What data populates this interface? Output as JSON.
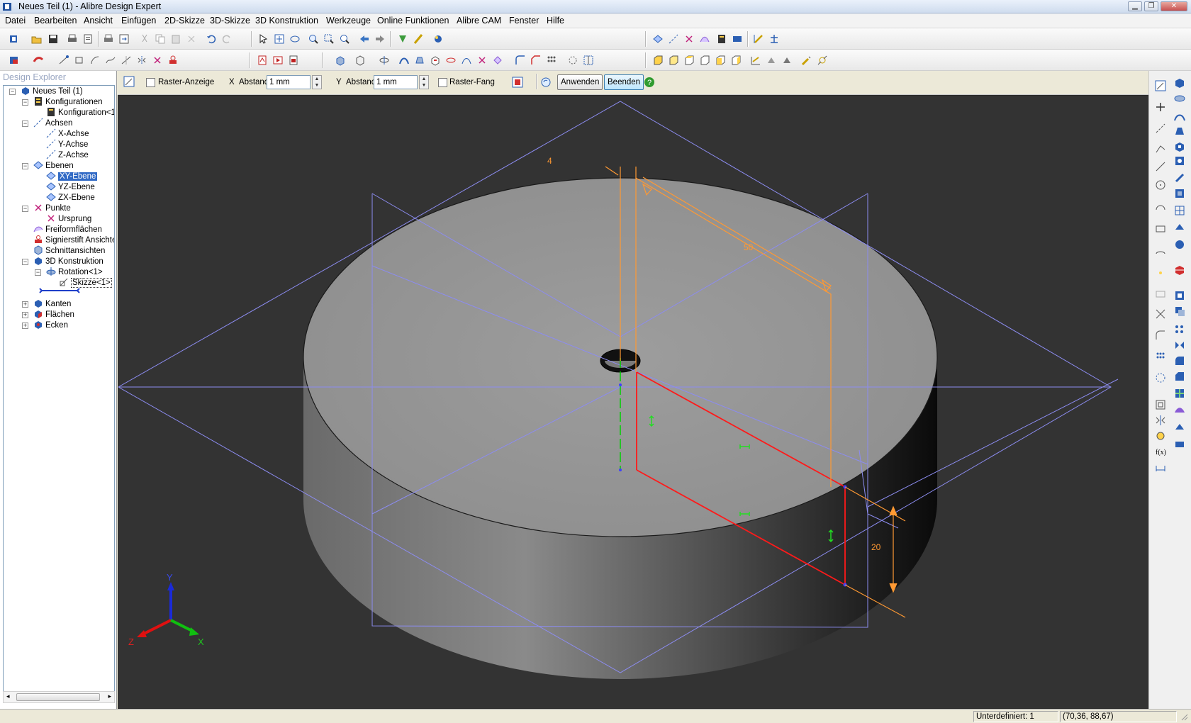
{
  "window": {
    "title": "Neues Teil (1) - Alibre Design Expert",
    "buttons": [
      "minimize",
      "restore",
      "close"
    ]
  },
  "menu": [
    "Datei",
    "Bearbeiten",
    "Ansicht",
    "Einfügen",
    "2D-Skizze",
    "3D-Skizze",
    "3D Konstruktion",
    "Werkzeuge",
    "Online Funktionen",
    "Alibre CAM",
    "Fenster",
    "Hilfe"
  ],
  "explorer": {
    "title": "Design Explorer",
    "tree": [
      {
        "label": "Neues Teil (1)",
        "icon": "part-icon"
      },
      {
        "label": "Konfigurationen",
        "icon": "configurations-icon"
      },
      {
        "label": "Konfiguration<1:",
        "icon": "configuration-icon"
      },
      {
        "label": "Achsen",
        "icon": "axes-icon"
      },
      {
        "label": "X-Achse",
        "icon": "axis-icon"
      },
      {
        "label": "Y-Achse",
        "icon": "axis-icon"
      },
      {
        "label": "Z-Achse",
        "icon": "axis-icon"
      },
      {
        "label": "Ebenen",
        "icon": "planes-icon"
      },
      {
        "label": "XY-Ebene",
        "icon": "plane-icon"
      },
      {
        "label": "YZ-Ebene",
        "icon": "plane-icon"
      },
      {
        "label": "ZX-Ebene",
        "icon": "plane-icon"
      },
      {
        "label": "Punkte",
        "icon": "points-icon"
      },
      {
        "label": "Ursprung",
        "icon": "origin-icon"
      },
      {
        "label": "Freiformflächen",
        "icon": "freeform-icon"
      },
      {
        "label": "Signierstift Ansichten",
        "icon": "pen-icon"
      },
      {
        "label": "Schnittansichten",
        "icon": "section-icon"
      },
      {
        "label": "3D Konstruktion",
        "icon": "features-icon"
      },
      {
        "label": "Rotation<1>",
        "icon": "revolve-icon"
      },
      {
        "label": "Skizze<1>",
        "icon": "sketch-icon"
      },
      {
        "label": "Kanten",
        "icon": "edges-icon"
      },
      {
        "label": "Flächen",
        "icon": "faces-icon"
      },
      {
        "label": "Ecken",
        "icon": "vertices-icon"
      }
    ]
  },
  "sketchbar": {
    "grid_display": "Raster-Anzeige",
    "x_axis": "X",
    "x_spacing_label": "Abstand",
    "x_spacing_value": "1 mm",
    "y_axis": "Y",
    "y_spacing_label": "Abstand",
    "y_spacing_value": "1 mm",
    "grid_snap": "Raster-Fang",
    "apply": "Anwenden",
    "finish": "Beenden"
  },
  "viewport": {
    "dimension_4": "4",
    "dimension_50": "50",
    "dimension_20": "20",
    "triad": {
      "x": "X",
      "y": "Y",
      "z": "Z"
    },
    "colors": {
      "background": "#333333",
      "sketch": "#ff0000",
      "dimension": "#ff9933",
      "plane": "#8080d0",
      "axis_y": "#00cc00"
    }
  },
  "status": {
    "state": "Unterdefiniert: 1",
    "coords": "(70,36, 88,67)"
  }
}
